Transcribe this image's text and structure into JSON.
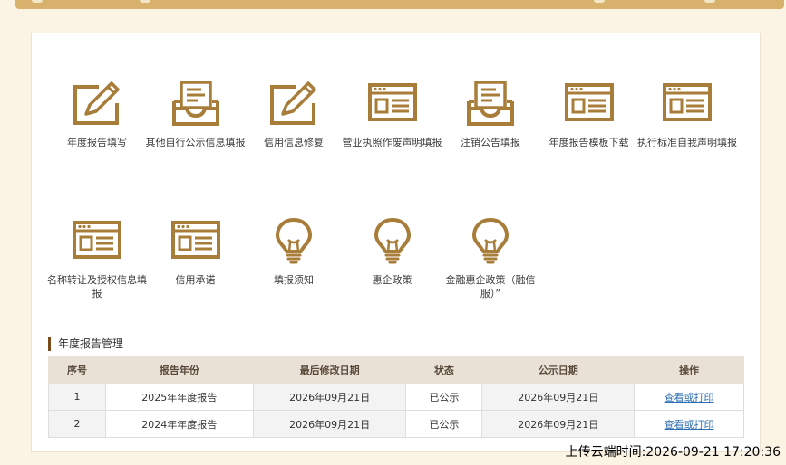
{
  "accent_color": "#a87d3a",
  "tiles_row1": [
    {
      "label": "年度报告填写",
      "icon": "edit-icon"
    },
    {
      "label": "其他自行公示信息填报",
      "icon": "inbox-tray-icon"
    },
    {
      "label": "信用信息修复",
      "icon": "edit-icon"
    },
    {
      "label": "营业执照作废声明填报",
      "icon": "web-form-icon"
    },
    {
      "label": "注销公告填报",
      "icon": "inbox-tray-icon"
    },
    {
      "label": "年度报告模板下载",
      "icon": "web-form-icon"
    },
    {
      "label": "执行标准自我声明填报",
      "icon": "web-form-icon"
    }
  ],
  "tiles_row2": [
    {
      "label": "名称转让及授权信息填报",
      "icon": "web-form-icon"
    },
    {
      "label": "信用承诺",
      "icon": "web-form-icon"
    },
    {
      "label": "填报须知",
      "icon": "lightbulb-icon"
    },
    {
      "label": "惠企政策",
      "icon": "lightbulb-icon"
    },
    {
      "label": "金融惠企政策（融信服）”",
      "icon": "lightbulb-icon"
    }
  ],
  "section_title": "年度报告管理",
  "table": {
    "headers": [
      "序号",
      "报告年份",
      "最后修改日期",
      "状态",
      "公示日期",
      "操作"
    ],
    "rows": [
      [
        "1",
        "2025年年度报告",
        "2026年09月21日",
        "已公示",
        "2026年09月21日",
        "查看或打印"
      ],
      [
        "2",
        "2024年年度报告",
        "2026年09月21日",
        "已公示",
        "2026年09月21日",
        "查看或打印"
      ]
    ]
  },
  "upload_stamp": "上传云端时间:2026-09-21 17:20:36"
}
